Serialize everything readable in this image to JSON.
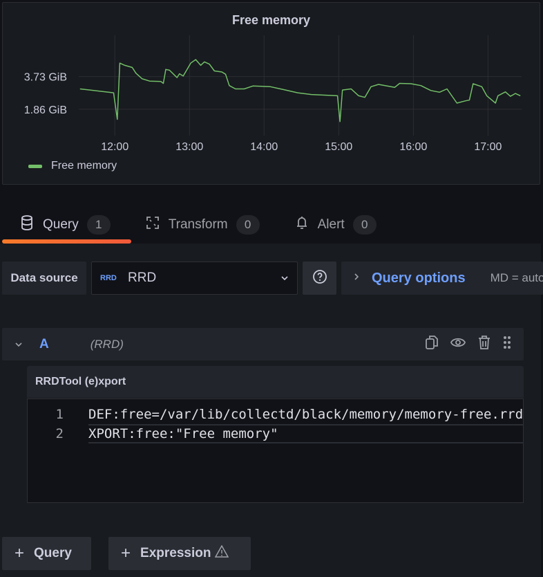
{
  "panel": {
    "title": "Free memory"
  },
  "chart_data": {
    "type": "line",
    "title": "Free memory",
    "y_ticks": [
      "3.73 GiB",
      "1.86 GiB"
    ],
    "y_tick_values": [
      3.73,
      1.86
    ],
    "x_ticks": [
      "12:00",
      "13:00",
      "14:00",
      "15:00",
      "16:00",
      "17:00"
    ],
    "xlim": [
      "11:31",
      "17:27"
    ],
    "ylim": [
      0.35,
      5.1
    ],
    "grid": true,
    "legend": "bottom-left",
    "series": [
      {
        "name": "Free memory",
        "color": "#73bf69",
        "x": [
          "11:32",
          "11:59",
          "12:02",
          "12:04",
          "12:08",
          "12:14",
          "12:17",
          "12:22",
          "12:28",
          "12:37",
          "12:39",
          "12:41",
          "12:44",
          "12:50",
          "12:52",
          "12:55",
          "13:01",
          "13:05",
          "13:09",
          "13:12",
          "13:16",
          "13:20",
          "13:26",
          "13:29",
          "13:32",
          "13:37",
          "13:44",
          "13:51",
          "14:05",
          "14:16",
          "14:27",
          "14:38",
          "14:59",
          "15:01",
          "15:03",
          "15:10",
          "15:16",
          "15:21",
          "15:26",
          "15:32",
          "15:45",
          "15:49",
          "15:58",
          "16:06",
          "16:14",
          "16:21",
          "16:27",
          "16:35",
          "16:42",
          "16:45",
          "16:48",
          "16:55",
          "16:59",
          "17:06",
          "17:08",
          "17:14",
          "17:18",
          "17:22",
          "17:26"
        ],
        "y": [
          3.02,
          2.8,
          1.28,
          4.5,
          4.37,
          4.25,
          3.92,
          3.6,
          3.47,
          3.45,
          3.34,
          4.14,
          4.09,
          3.67,
          3.89,
          3.76,
          4.5,
          4.7,
          4.37,
          4.57,
          4.44,
          4.05,
          3.99,
          3.86,
          3.21,
          3.02,
          3.02,
          3.19,
          3.15,
          2.98,
          2.8,
          2.7,
          2.63,
          1.15,
          2.96,
          3.02,
          2.63,
          2.54,
          3.15,
          3.28,
          3.11,
          3.34,
          3.32,
          3.21,
          2.93,
          2.83,
          3.02,
          2.21,
          2.34,
          2.38,
          3.32,
          3.15,
          2.63,
          2.21,
          2.63,
          2.85,
          2.6,
          2.76,
          2.63
        ]
      }
    ]
  },
  "tabs": [
    {
      "label": "Query",
      "count": "1",
      "icon": "database-icon"
    },
    {
      "label": "Transform",
      "count": "0",
      "icon": "transform-icon"
    },
    {
      "label": "Alert",
      "count": "0",
      "icon": "bell-icon"
    }
  ],
  "datasource": {
    "label": "Data source",
    "logo": "RRD",
    "value": "RRD",
    "options_label": "Query options",
    "md": "MD = auto"
  },
  "query": {
    "ref": "A",
    "datasource": "(RRD)",
    "editor_title": "RRDTool (e)xport",
    "lines": [
      "DEF:free=/var/lib/collectd/black/memory/memory-free.rrd:value:AVERAGE",
      "XPORT:free:\"Free memory\""
    ],
    "line_numbers": [
      "1",
      "2"
    ]
  },
  "buttons": {
    "add_query": "Query",
    "add_expression": "Expression"
  },
  "colors": {
    "accent": "#6e9fff",
    "series": "#73bf69",
    "tab_underline": "#f87a2a"
  }
}
